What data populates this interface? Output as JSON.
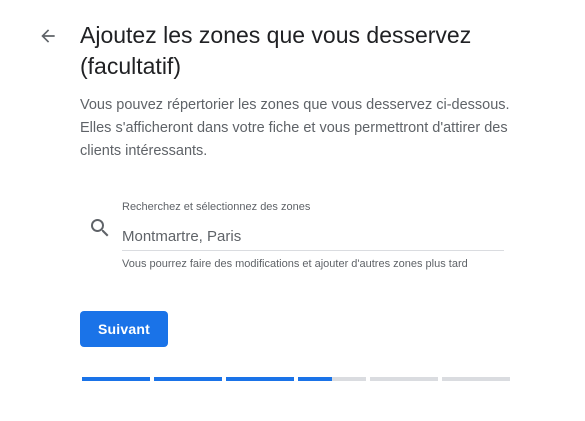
{
  "header": {
    "title": "Ajoutez les zones que vous desservez (facultatif)"
  },
  "description": "Vous pouvez répertorier les zones que vous desservez ci-dessous. Elles s'afficheront dans votre fiche et vous permettront d'attirer des clients intéressants.",
  "search": {
    "label": "Recherchez et sélectionnez des zones",
    "value": "Montmartre, Paris",
    "helper": "Vous pourrez faire des modifications et ajouter d'autres zones plus tard"
  },
  "actions": {
    "next_label": "Suivant"
  },
  "progress": {
    "segments": [
      1,
      1,
      1,
      0.5,
      0,
      0
    ]
  },
  "colors": {
    "accent": "#1a73e8",
    "track": "#dadce0",
    "title": "#202124",
    "secondary_text": "#5f6368"
  },
  "icons": {
    "back": "arrow-back-icon",
    "search": "search-icon"
  }
}
